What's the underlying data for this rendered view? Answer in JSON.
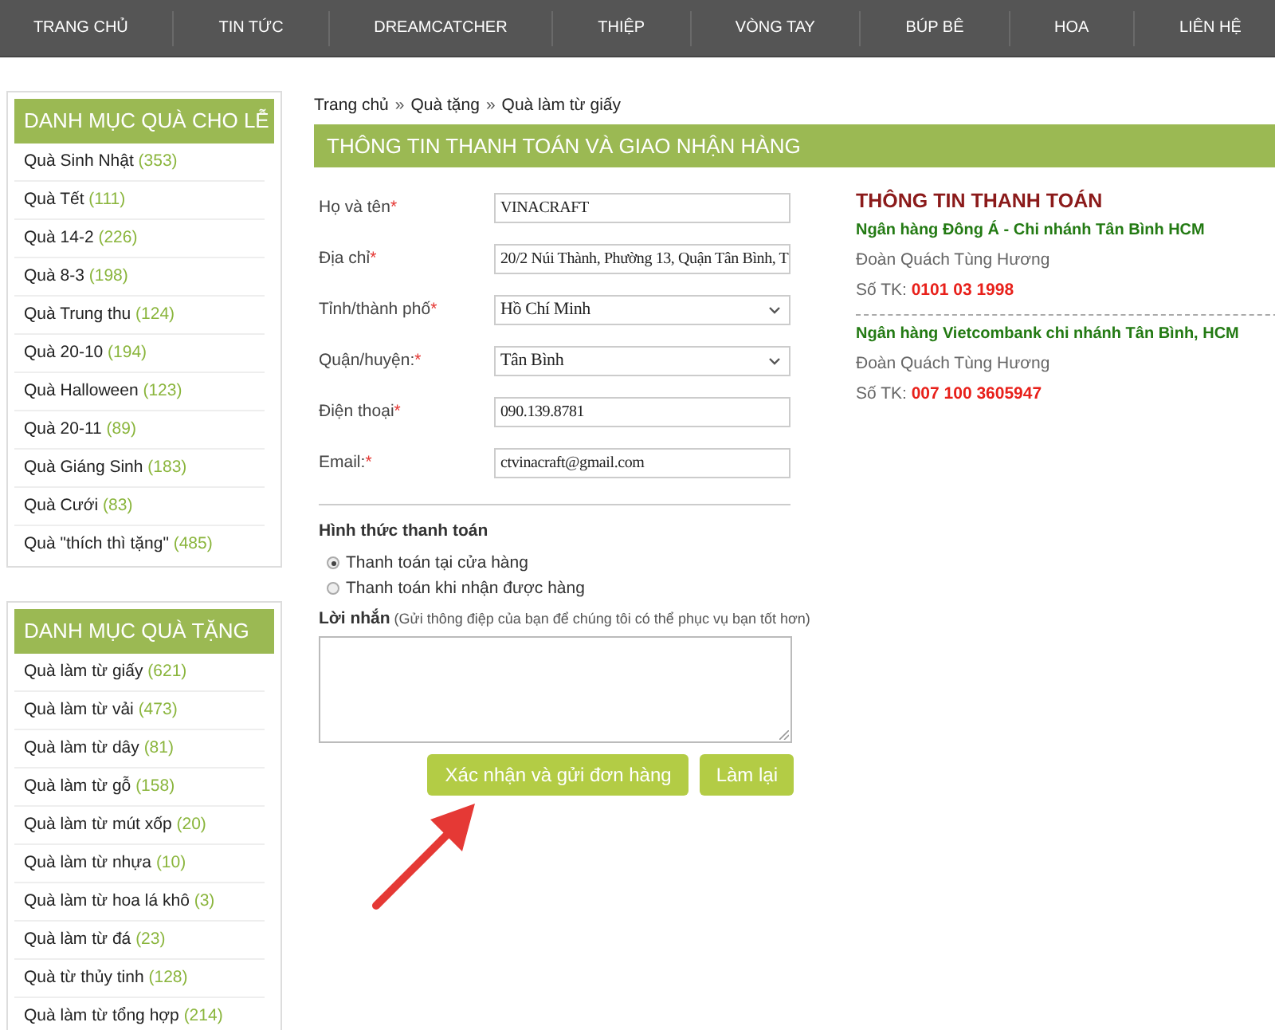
{
  "nav": [
    {
      "label": "TRANG CHỦ"
    },
    {
      "label": "TIN TỨC"
    },
    {
      "label": "DREAMCATCHER"
    },
    {
      "label": "THIỆP"
    },
    {
      "label": "VÒNG TAY"
    },
    {
      "label": "BÚP BÊ"
    },
    {
      "label": "HOA"
    },
    {
      "label": "LIÊN HỆ"
    }
  ],
  "sidebar": [
    {
      "title": "DANH MỤC QUÀ CHO LỄ",
      "items": [
        {
          "name": "Quà Sinh Nhật",
          "count": "(353)"
        },
        {
          "name": "Quà Tết",
          "count": "(111)"
        },
        {
          "name": "Quà 14-2",
          "count": "(226)"
        },
        {
          "name": "Quà 8-3",
          "count": "(198)"
        },
        {
          "name": "Quà Trung thu",
          "count": "(124)"
        },
        {
          "name": "Quà 20-10",
          "count": "(194)"
        },
        {
          "name": "Quà Halloween",
          "count": "(123)"
        },
        {
          "name": "Quà 20-11",
          "count": "(89)"
        },
        {
          "name": "Quà Giáng Sinh",
          "count": "(183)"
        },
        {
          "name": "Quà Cưới",
          "count": "(83)"
        },
        {
          "name": "Quà \"thích thì tặng\"",
          "count": "(485)"
        }
      ]
    },
    {
      "title": "DANH MỤC QUÀ TẶNG",
      "items": [
        {
          "name": "Quà làm từ giấy",
          "count": "(621)"
        },
        {
          "name": "Quà làm từ vải",
          "count": "(473)"
        },
        {
          "name": "Quà làm từ dây",
          "count": "(81)"
        },
        {
          "name": "Quà làm từ gỗ",
          "count": "(158)"
        },
        {
          "name": "Quà làm từ mút xốp",
          "count": "(20)"
        },
        {
          "name": "Quà làm từ nhựa",
          "count": "(10)"
        },
        {
          "name": "Quà làm từ hoa lá khô",
          "count": "(3)"
        },
        {
          "name": "Quà làm từ đá",
          "count": "(23)"
        },
        {
          "name": "Quà từ thủy tinh",
          "count": "(128)"
        },
        {
          "name": "Quà làm từ tổng hợp",
          "count": "(214)"
        }
      ]
    }
  ],
  "breadcrumb": [
    {
      "label": "Trang chủ"
    },
    {
      "separator": "»"
    },
    {
      "label": "Quà tặng"
    },
    {
      "separator": "»"
    },
    {
      "label": "Quà làm từ giấy"
    }
  ],
  "heading": "THÔNG TIN THANH TOÁN VÀ GIAO NHẬN HÀNG",
  "fields": [
    {
      "label": "Họ và tên",
      "mark": "*",
      "kind": "text",
      "value": "VINACRAFT"
    },
    {
      "label": "Địa chỉ",
      "mark": "*",
      "kind": "text",
      "value": "20/2 Núi Thành, Phường 13, Quận Tân Bình, T"
    },
    {
      "label": "Tỉnh/thành phố",
      "mark": "*",
      "kind": "select",
      "value": "Hồ Chí Minh"
    },
    {
      "label": "Quận/huyện:",
      "mark": "*",
      "kind": "select",
      "value": "Tân Bình"
    },
    {
      "label": "Điện thoại",
      "mark": "*",
      "kind": "text",
      "value": "090.139.8781"
    },
    {
      "label": "Email:",
      "mark": "*",
      "kind": "text",
      "value": "ctvinacraft@gmail.com"
    }
  ],
  "payment": {
    "title": "Hình thức thanh toán",
    "options": [
      {
        "label": "Thanh toán tại cửa hàng",
        "selected": true
      },
      {
        "label": "Thanh toán khi nhận được hàng",
        "selected": false
      }
    ]
  },
  "message": {
    "label": "**Lời nhắn** (Gửi thông điệp của bạn để chúng tôi có thể phục vụ bạn tốt hơn)"
  },
  "buttons": [
    {
      "label": "Xác nhận và gửi đơn hàng"
    },
    {
      "label": "Làm lại"
    }
  ],
  "bank_info": {
    "title": "THÔNG TIN THANH TOÁN",
    "banks": [
      {
        "name": "Ngân hàng Đông Á - Chi nhánh Tân Bình HCM",
        "holder": "Đoàn Quách Tùng Hương",
        "account_label": "Số TK:",
        "account": "0101 03 1998"
      },
      {
        "name": "Ngân hàng Vietcombank chi nhánh Tân Bình, HCM",
        "holder": "Đoàn Quách Tùng Hương",
        "account_label": "Số TK:",
        "account": "007 100 3605947"
      }
    ]
  }
}
